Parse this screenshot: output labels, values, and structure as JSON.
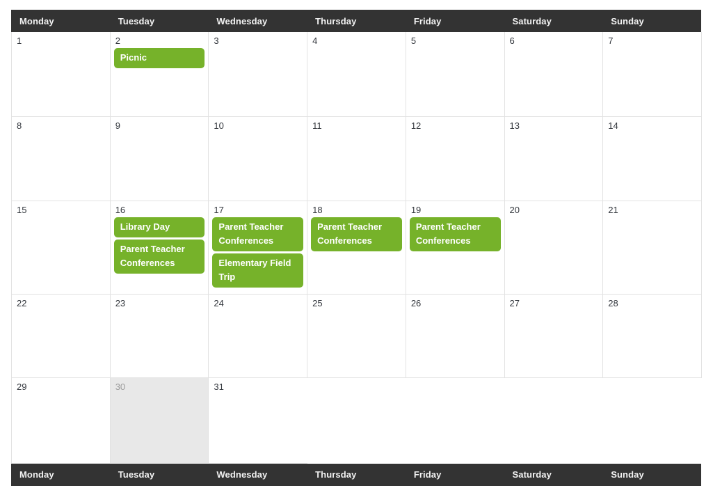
{
  "colors": {
    "bar_background": "#333333",
    "bar_text": "#f2f2f2",
    "event_background": "#76b22a",
    "event_text": "#ffffff",
    "today_background": "#e8e8e8",
    "grid_border": "#e2e2e2",
    "day_number": "#33373d"
  },
  "header": {
    "days": [
      {
        "label": "Monday"
      },
      {
        "label": "Tuesday"
      },
      {
        "label": "Wednesday"
      },
      {
        "label": "Thursday"
      },
      {
        "label": "Friday"
      },
      {
        "label": "Saturday"
      },
      {
        "label": "Sunday"
      }
    ]
  },
  "footer": {
    "days": [
      {
        "label": "Monday"
      },
      {
        "label": "Tuesday"
      },
      {
        "label": "Wednesday"
      },
      {
        "label": "Thursday"
      },
      {
        "label": "Friday"
      },
      {
        "label": "Saturday"
      },
      {
        "label": "Sunday"
      }
    ]
  },
  "weeks": [
    {
      "days": [
        {
          "number": "1",
          "today": false,
          "blank": false,
          "events": []
        },
        {
          "number": "2",
          "today": false,
          "blank": false,
          "events": [
            {
              "title": "Picnic"
            }
          ]
        },
        {
          "number": "3",
          "today": false,
          "blank": false,
          "events": []
        },
        {
          "number": "4",
          "today": false,
          "blank": false,
          "events": []
        },
        {
          "number": "5",
          "today": false,
          "blank": false,
          "events": []
        },
        {
          "number": "6",
          "today": false,
          "blank": false,
          "events": []
        },
        {
          "number": "7",
          "today": false,
          "blank": false,
          "events": []
        }
      ]
    },
    {
      "days": [
        {
          "number": "8",
          "today": false,
          "blank": false,
          "events": []
        },
        {
          "number": "9",
          "today": false,
          "blank": false,
          "events": []
        },
        {
          "number": "10",
          "today": false,
          "blank": false,
          "events": []
        },
        {
          "number": "11",
          "today": false,
          "blank": false,
          "events": []
        },
        {
          "number": "12",
          "today": false,
          "blank": false,
          "events": []
        },
        {
          "number": "13",
          "today": false,
          "blank": false,
          "events": []
        },
        {
          "number": "14",
          "today": false,
          "blank": false,
          "events": []
        }
      ]
    },
    {
      "days": [
        {
          "number": "15",
          "today": false,
          "blank": false,
          "events": []
        },
        {
          "number": "16",
          "today": false,
          "blank": false,
          "events": [
            {
              "title": "Library Day"
            },
            {
              "title": "Parent Teacher Conferences"
            }
          ]
        },
        {
          "number": "17",
          "today": false,
          "blank": false,
          "events": [
            {
              "title": "Parent Teacher Conferences"
            },
            {
              "title": "Elementary Field Trip"
            }
          ]
        },
        {
          "number": "18",
          "today": false,
          "blank": false,
          "events": [
            {
              "title": "Parent Teacher Conferences"
            }
          ]
        },
        {
          "number": "19",
          "today": false,
          "blank": false,
          "events": [
            {
              "title": "Parent Teacher Conferences"
            }
          ]
        },
        {
          "number": "20",
          "today": false,
          "blank": false,
          "events": []
        },
        {
          "number": "21",
          "today": false,
          "blank": false,
          "events": []
        }
      ]
    },
    {
      "days": [
        {
          "number": "22",
          "today": false,
          "blank": false,
          "events": []
        },
        {
          "number": "23",
          "today": false,
          "blank": false,
          "events": []
        },
        {
          "number": "24",
          "today": false,
          "blank": false,
          "events": []
        },
        {
          "number": "25",
          "today": false,
          "blank": false,
          "events": []
        },
        {
          "number": "26",
          "today": false,
          "blank": false,
          "events": []
        },
        {
          "number": "27",
          "today": false,
          "blank": false,
          "events": []
        },
        {
          "number": "28",
          "today": false,
          "blank": false,
          "events": []
        }
      ]
    },
    {
      "days": [
        {
          "number": "29",
          "today": false,
          "blank": false,
          "events": []
        },
        {
          "number": "30",
          "today": true,
          "blank": false,
          "events": []
        },
        {
          "number": "31",
          "today": false,
          "blank": false,
          "events": []
        },
        {
          "number": "",
          "today": false,
          "blank": true,
          "events": []
        },
        {
          "number": "",
          "today": false,
          "blank": true,
          "events": []
        },
        {
          "number": "",
          "today": false,
          "blank": true,
          "events": []
        },
        {
          "number": "",
          "today": false,
          "blank": true,
          "events": []
        }
      ]
    }
  ]
}
